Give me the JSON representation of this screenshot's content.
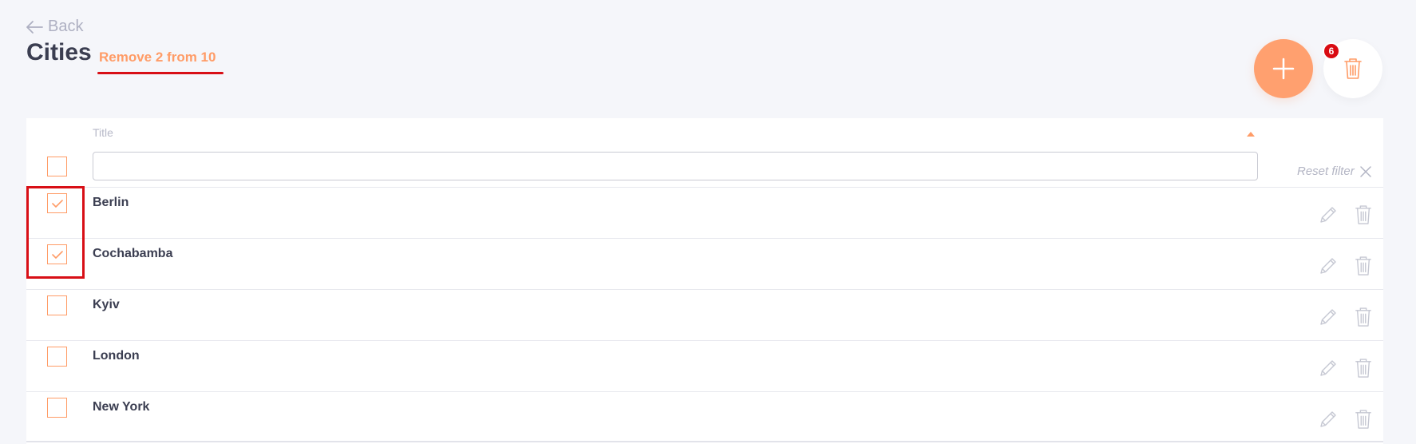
{
  "header": {
    "back_label": "Back",
    "title": "Cities",
    "remove_link": "Remove 2 from 10"
  },
  "actions": {
    "add_icon": "plus-icon",
    "delete_icon": "trash-icon",
    "delete_badge": "6"
  },
  "table": {
    "column_title": "Title",
    "sort_direction": "ascending",
    "filter_value": "",
    "reset_filter_label": "Reset filter",
    "rows": [
      {
        "label": "Berlin",
        "checked": true
      },
      {
        "label": "Cochabamba",
        "checked": true
      },
      {
        "label": "Kyiv",
        "checked": false
      },
      {
        "label": "London",
        "checked": false
      },
      {
        "label": "New York",
        "checked": false
      }
    ]
  },
  "colors": {
    "accent": "#ff9c67",
    "highlight": "#d80f16",
    "background": "#f5f6fa"
  }
}
